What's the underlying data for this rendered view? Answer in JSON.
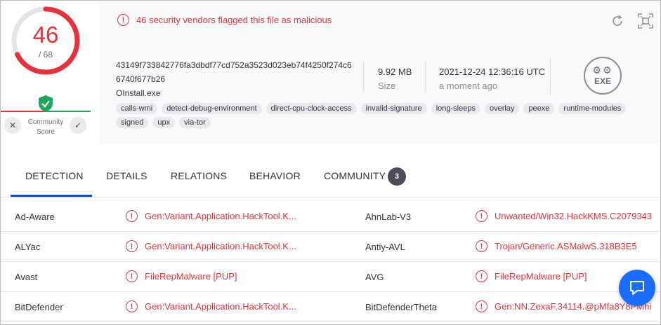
{
  "score": {
    "positives": "46",
    "total": "/ 68"
  },
  "community": {
    "label": "Community Score",
    "down_icon": "close-icon",
    "up_icon": "check-icon"
  },
  "alert": {
    "text": "46 security vendors flagged this file as malicious"
  },
  "file": {
    "hash": "43149f733842776fa3dbdf77cd752a3523d023eb74f4250f274c66740f677b26",
    "name": "OInstall.exe",
    "size_value": "9.92 MB",
    "size_label": "Size",
    "date_value": "2021-12-24 12:36:16 UTC",
    "date_label": "a moment ago",
    "type_label": "EXE"
  },
  "tags": [
    "calls-wmi",
    "detect-debug-environment",
    "direct-cpu-clock-access",
    "invalid-signature",
    "long-sleeps",
    "overlay",
    "peexe",
    "runtime-modules",
    "signed",
    "upx",
    "via-tor"
  ],
  "tabs": [
    {
      "label": "DETECTION",
      "active": true
    },
    {
      "label": "DETAILS"
    },
    {
      "label": "RELATIONS"
    },
    {
      "label": "BEHAVIOR"
    },
    {
      "label": "COMMUNITY",
      "badge": "3"
    }
  ],
  "detections": [
    {
      "vendor1": "Ad-Aware",
      "result1": "Gen:Variant.Application.HackTool.K...",
      "vendor2": "AhnLab-V3",
      "result2": "Unwanted/Win32.HackKMS.C2079343"
    },
    {
      "vendor1": "ALYac",
      "result1": "Gen:Variant.Application.HackTool.K...",
      "vendor2": "Antiy-AVL",
      "result2": "Trojan/Generic.ASMalwS.318B3E5"
    },
    {
      "vendor1": "Avast",
      "result1": "FileRepMalware [PUP]",
      "vendor2": "AVG",
      "result2": "FileRepMalware [PUP]"
    },
    {
      "vendor1": "BitDefender",
      "result1": "Gen:Variant.Application.HackTool.K...",
      "vendor2": "BitDefenderTheta",
      "result2": "Gen:NN.ZexaF.34114.@pMfa8Y8PMhi"
    }
  ],
  "colors": {
    "malicious": "#e5323b",
    "harmless": "#1fa55e",
    "accent": "#0b4dda",
    "chat": "#1a6dff"
  }
}
